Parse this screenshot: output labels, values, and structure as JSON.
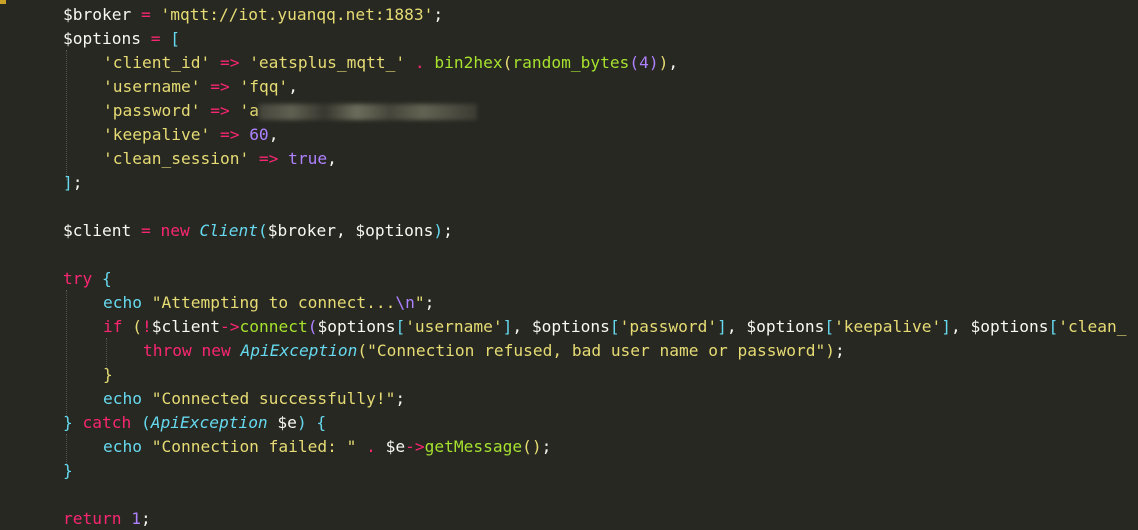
{
  "editor": {
    "lines": {
      "l1": {
        "var": "$broker",
        "op": " = ",
        "str": "'mqtt://iot.yuanqq.net:1883'",
        "end": ";"
      },
      "l2": {
        "var": "$options",
        "op": " = ",
        "br": "["
      },
      "l3": {
        "key": "'client_id'",
        "arrow": " => ",
        "str": "'eatsplus_mqtt_'",
        "dot": " . ",
        "fn1": "bin2hex",
        "p1": "(",
        "fn2": "random_bytes",
        "p2": "(",
        "num": "4",
        "p2c": ")",
        "p1c": ")",
        "end": ","
      },
      "l4": {
        "key": "'username'",
        "arrow": " => ",
        "str": "'fqq'",
        "end": ","
      },
      "l5": {
        "key": "'password'",
        "arrow": " => ",
        "str": "'a"
      },
      "l6": {
        "key": "'keepalive'",
        "arrow": " => ",
        "num": "60",
        "end": ","
      },
      "l7": {
        "key": "'clean_session'",
        "arrow": " => ",
        "const": "true",
        "end": ","
      },
      "l8": {
        "br": "]",
        "end": ";"
      },
      "l10": {
        "var": "$client",
        "op": " = ",
        "kw": "new",
        "cls": "Client",
        "p": "(",
        "args": "$broker, $options",
        "pc": ")",
        "end": ";"
      },
      "l12": {
        "kw": "try",
        "br": " {"
      },
      "l13": {
        "kw": "echo",
        "str1": " \"Attempting to connect...",
        "esc": "\\n",
        "str2": "\"",
        "end": ";"
      },
      "l14": {
        "kw": "if",
        "sp": " ",
        "p": "(",
        "not": "!",
        "var": "$client",
        "arrow": "->",
        "fn": "connect",
        "p2": "(",
        "a1": "$options",
        "b1": "[",
        "s1": "'username'",
        "b1c": "]",
        "c1": ", ",
        "a2": "$options",
        "b2": "[",
        "s2": "'password'",
        "b2c": "]",
        "c2": ", ",
        "a3": "$options",
        "b3": "[",
        "s3": "'keepalive'",
        "b3c": "]",
        "c3": ", ",
        "a4": "$options",
        "b4": "[",
        "s4": "'clean_"
      },
      "l15": {
        "kw1": "throw",
        "kw2": " new",
        "cls": " ApiException",
        "p": "(",
        "str": "\"Connection refused, bad user name or password\"",
        "pc": ")",
        "end": ";"
      },
      "l16": {
        "br": "}"
      },
      "l17": {
        "kw": "echo",
        "str": " \"Connected successfully!\"",
        "end": ";"
      },
      "l18": {
        "br1": "}",
        "kw": " catch",
        "p": " (",
        "cls": "ApiException",
        "var": " $e",
        "pc": ")",
        "br2": " {"
      },
      "l19": {
        "kw": "echo",
        "str": " \"Connection failed: \"",
        "dot": " . ",
        "var": "$e",
        "arrow": "->",
        "fn": "getMessage",
        "p": "()",
        "end": ";"
      },
      "l20": {
        "br": "}"
      },
      "l22": {
        "kw": "return",
        "num": " 1",
        "end": ";"
      }
    }
  },
  "colors": {
    "background": "#272822",
    "keyword": "#f92672",
    "string": "#e6db74",
    "function": "#a6e22e",
    "number": "#ae81ff",
    "class": "#66d9ef"
  }
}
